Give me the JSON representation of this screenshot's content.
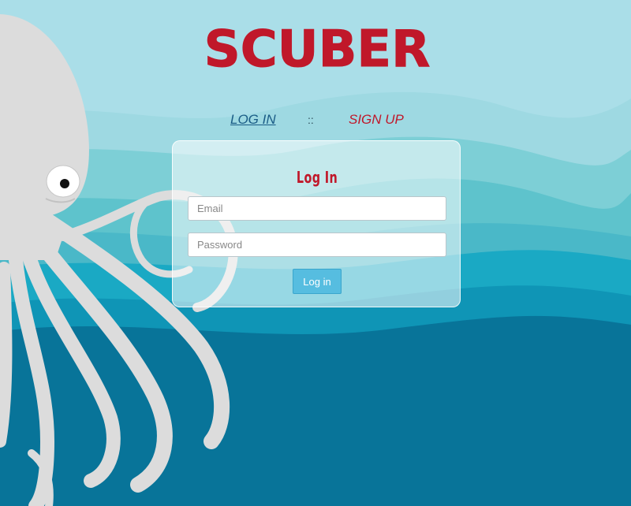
{
  "brand": {
    "name": "SCUBER",
    "color": "#c0182a"
  },
  "nav": {
    "login_label": "LOG IN",
    "separator": "::",
    "signup_label": "SIGN UP"
  },
  "form": {
    "title": "Log In",
    "email_placeholder": "Email",
    "email_value": "",
    "password_placeholder": "Password",
    "password_value": "",
    "submit_label": "Log in"
  },
  "colors": {
    "sky": "#aadee8",
    "deep_sea": "#087499",
    "accent_button": "#56bde0",
    "nav_login": "#1a5c86"
  },
  "illustration": {
    "subject": "octopus-icon"
  }
}
